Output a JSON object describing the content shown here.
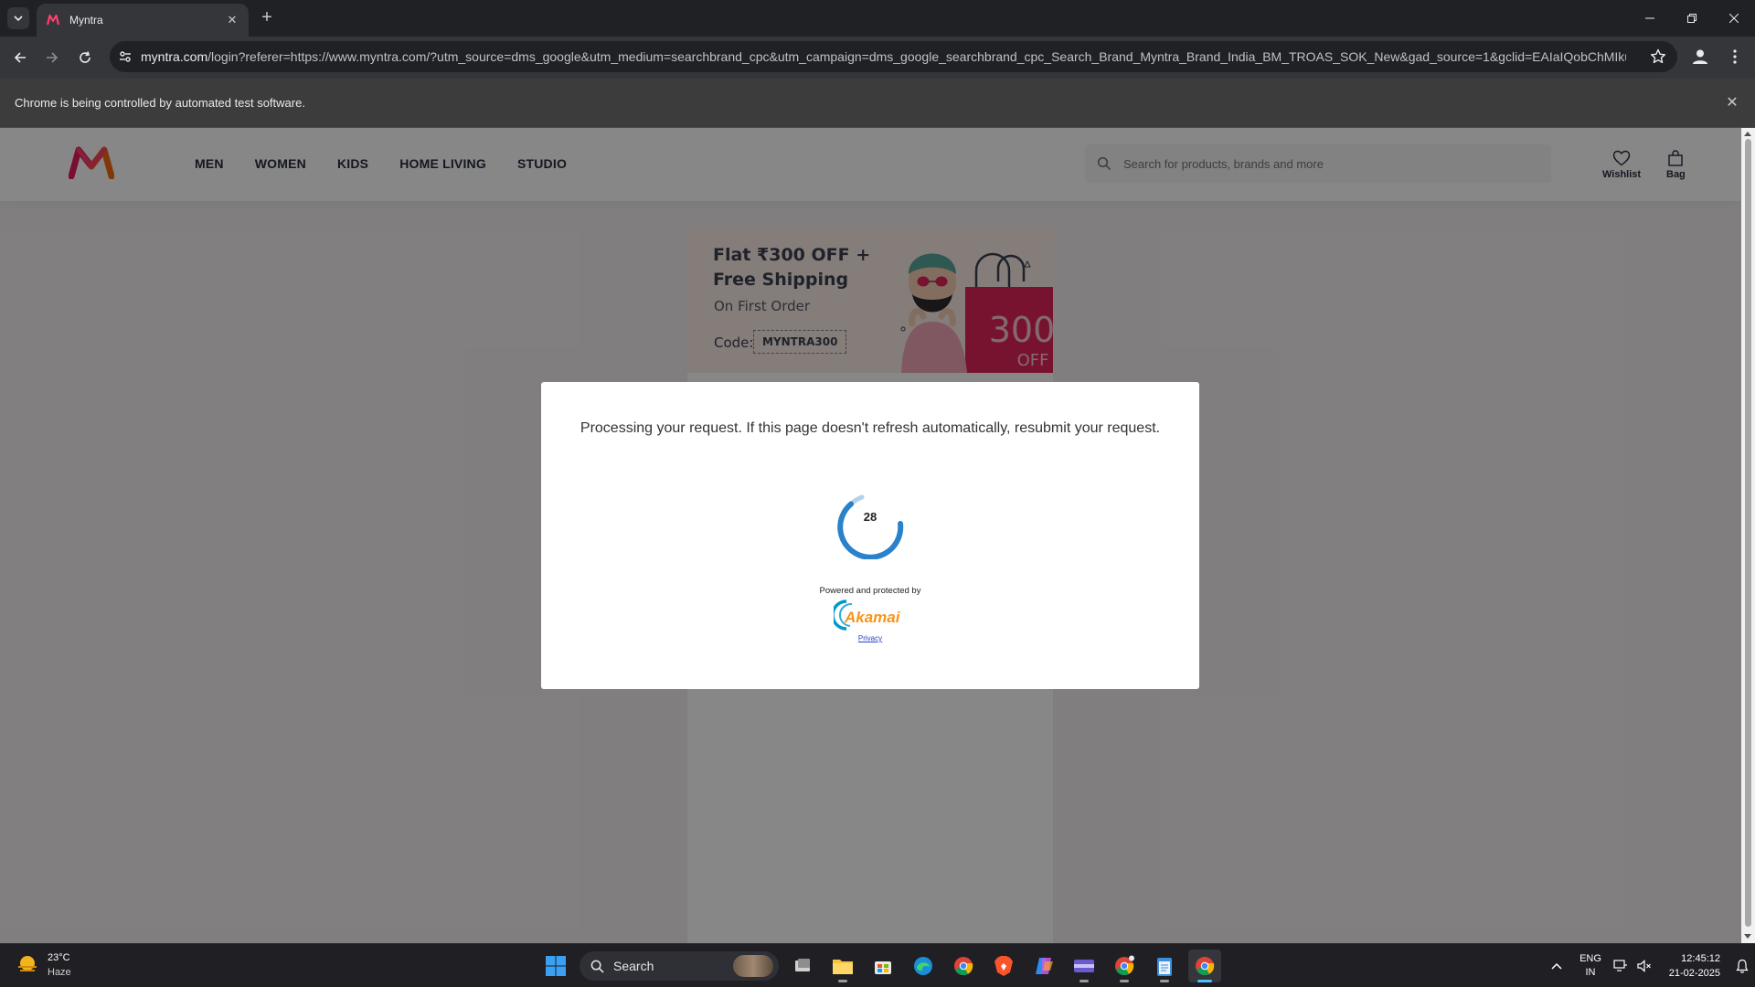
{
  "browser": {
    "tab_title": "Myntra",
    "url_domain": "myntra.com",
    "url_rest": "/login?referer=https://www.myntra.com/?utm_source=dms_google&utm_medium=searchbrand_cpc&utm_campaign=dms_google_searchbrand_cpc_Search_Brand_Myntra_Brand_India_BM_TROAS_SOK_New&gad_source=1&gclid=EAIaIQobChMIku-N-...",
    "infobar_text": "Chrome is being controlled by automated test software."
  },
  "site": {
    "nav": [
      "MEN",
      "WOMEN",
      "KIDS",
      "HOME LIVING",
      "STUDIO"
    ],
    "search_placeholder": "Search for products, brands and more",
    "wishlist_label": "Wishlist",
    "bag_label": "Bag"
  },
  "promo": {
    "line1": "Flat ₹300 OFF +",
    "line2": "Free Shipping",
    "line3": "On First Order",
    "code_label": "Code:",
    "code": "MYNTRA300",
    "art_big": "300",
    "art_small": "OFF"
  },
  "modal": {
    "message": "Processing your request. If this page doesn't refresh automatically, resubmit your request.",
    "countdown": "28",
    "powered_by": "Powered and protected by",
    "brand": "Akamai",
    "privacy": "Privacy"
  },
  "taskbar": {
    "temperature": "23°C",
    "weather": "Haze",
    "search_label": "Search",
    "lang_1": "ENG",
    "lang_2": "IN",
    "time": "12:45:12",
    "date": "21-02-2025"
  },
  "colors": {
    "myntra_pink": "#ff3f6c",
    "spinner_blue": "#1f7bc8",
    "akamai_orange": "#f7941d",
    "akamai_blue": "#0099cc"
  }
}
